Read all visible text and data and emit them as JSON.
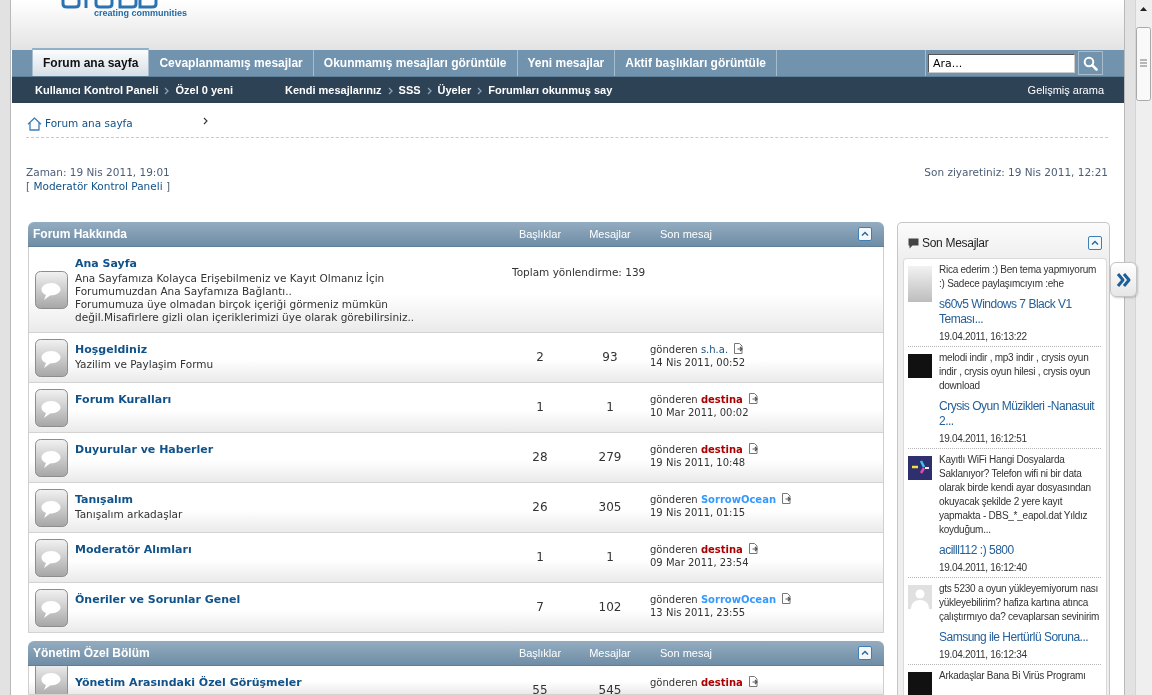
{
  "header": {
    "logo_tagline": "creating communities"
  },
  "nav_tabs": [
    {
      "label": "Forum ana sayfa",
      "selected": true
    },
    {
      "label": "Cevaplanmamış mesajlar",
      "selected": false
    },
    {
      "label": "Okunmamış mesajları görüntüle",
      "selected": false
    },
    {
      "label": "Yeni mesajlar",
      "selected": false
    },
    {
      "label": "Aktif başlıkları görüntüle",
      "selected": false
    }
  ],
  "search": {
    "value": "Ara..."
  },
  "sub_nav": {
    "left_links": [
      "Kullanıcı Kontrol Paneli",
      "Özel 0 yeni"
    ],
    "middle_links": [
      "Kendi mesajlarınız",
      "SSS",
      "Üyeler",
      "Forumları okunmuş say"
    ],
    "right_link": "Gelişmiş arama"
  },
  "breadcrumb": [
    {
      "kind": "home",
      "label": "Forum ana sayfa"
    }
  ],
  "info": {
    "current_time": "Zaman: 19 Nis 2011, 19:01",
    "mcp_link": {
      "open": "[",
      "label": "Moderatör Kontrol Paneli",
      "close": "]"
    },
    "last_visit": "Son ziyaretiniz: 19 Nis 2011, 12:21"
  },
  "categories": [
    {
      "title": "Forum Hakkında",
      "columns": [
        "Başlıklar",
        "Mesajlar",
        "Son mesaj"
      ],
      "forums": [
        {
          "kind": "redirect",
          "name": "Ana Sayfa",
          "description": [
            "Ana Sayfamıza Kolayca Erişebilmeniz ve Kayıt Olmanız İçin Forumumuzdan Ana Sayfamıza Bağlantı..",
            "Forumumuza üye olmadan birçok içeriği görmeniz mümkün değil.Misafirlere gizli olan içeriklerimizi üye olarak görebilirsiniz.."
          ],
          "redirects": "Toplam yönlendirme: 139"
        },
        {
          "kind": "forum",
          "name": "Hoşgeldiniz",
          "description": [
            "Yazilim ve Paylaşim Formu"
          ],
          "topics": "2",
          "posts": "93",
          "last_post": {
            "prefix": "gönderen",
            "author": "s.h.a.",
            "date": "14 Nis 2011, 00:52"
          }
        },
        {
          "kind": "forum",
          "name": "Forum Kuralları",
          "topics": "1",
          "posts": "1",
          "last_post": {
            "prefix": "gönderen",
            "author": "destina",
            "color": "#aa0000",
            "date": "10 Mar 2011, 00:02"
          }
        },
        {
          "kind": "forum",
          "name": "Duyurular ve Haberler",
          "topics": "28",
          "posts": "279",
          "last_post": {
            "prefix": "gönderen",
            "author": "destina",
            "color": "#aa0000",
            "date": "19 Nis 2011, 10:48"
          }
        },
        {
          "kind": "forum",
          "name": "Tanışalım",
          "description": [
            "Tanışalım arkadaşlar"
          ],
          "topics": "26",
          "posts": "305",
          "last_post": {
            "prefix": "gönderen",
            "author": "SorrowOcean",
            "color": "#3399ff",
            "date": "19 Nis 2011, 01:15"
          }
        },
        {
          "kind": "forum",
          "name": "Moderatör Alımları",
          "topics": "1",
          "posts": "1",
          "last_post": {
            "prefix": "gönderen",
            "author": "destina",
            "color": "#aa0000",
            "date": "09 Mar 2011, 23:54"
          }
        },
        {
          "kind": "forum",
          "name": "Öneriler ve Sorunlar Genel",
          "topics": "7",
          "posts": "102",
          "last_post": {
            "prefix": "gönderen",
            "author": "SorrowOcean",
            "color": "#3399ff",
            "date": "13 Nis 2011, 23:55"
          }
        }
      ]
    },
    {
      "title": "Yönetim Özel Bölüm",
      "columns": [
        "Başlıklar",
        "Mesajlar",
        "Son mesaj"
      ],
      "forums": [
        {
          "kind": "forum",
          "name": "Yönetim Arasındaki Özel Görüşmeler",
          "topics": "55",
          "posts": "545",
          "last_post": {
            "prefix": "gönderen",
            "author": "destina",
            "color": "#aa0000"
          }
        }
      ]
    }
  ],
  "recent_posts": {
    "title": "Son Mesajlar",
    "items": [
      {
        "kind": "figure",
        "excerpt": "Rica ederim :) Ben tema yapmıyorum :) Sadece paylaşımcıyım :ehe",
        "topic": "s60v5 Windows 7 Black V1 Teması...",
        "date": "19.04.2011, 16:13:22"
      },
      {
        "kind": "photo",
        "excerpt": "melodi indir , mp3 indir , crysis oyun indir , crysis oyun hilesi , crysis oyun download",
        "topic": "Crysis Oyun Müzikleri -Nanasuit 2...",
        "date": "19.04.2011, 16:12:51"
      },
      {
        "kind": "logo",
        "excerpt": "Kayıtlı WiFi Hangi Dosyalarda Saklanıyor? Telefon wifi ni bir data olarak birde kendi ayar dosyasından okuyacak şekilde 2 yere kayıt yapmakta - DBS_*_eapol.dat Yıldız koyduğum...",
        "topic": "acilll112 :) 5800",
        "date": "19.04.2011, 16:12:40"
      },
      {
        "kind": "silhouette",
        "excerpt": "gts 5230 a oyun yükleyemiyorum nası yükleyebilirim? hafiza kartına atınca çalıştırmıyo da? cevaplarsan sevinirim",
        "topic": "Samsung ile Hertürlü Soruna...",
        "date": "19.04.2011, 16:12:34"
      },
      {
        "kind": "photo",
        "excerpt": "Arkadaşlar Bana Bi Virüs Programı"
      }
    ]
  }
}
